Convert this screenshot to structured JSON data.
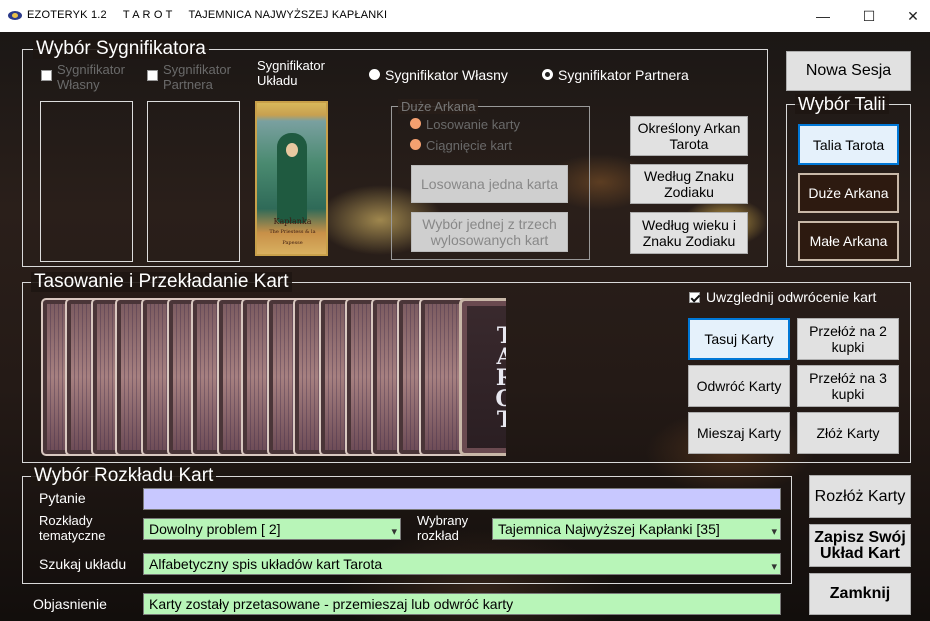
{
  "window": {
    "title": "EZOTERYK 1.2     T A R O T     TAJEMNICA NAJWYŻSZEJ KAPŁANKI",
    "min": "—",
    "max": "☐",
    "close": "✕"
  },
  "sygnifikator": {
    "legend": "Wybór Sygnifikatora",
    "own_label": "Sygnifikator Własny",
    "partner_label": "Sygnifikator Partnera",
    "layout_label": "Sygnifikator Układu",
    "radio_own": "Sygnifikator Własny",
    "radio_partner": "Sygnifikator Partnera",
    "card_caption": "Kapłanka",
    "card_caption_sub": "The Priestess & la Papesse"
  },
  "duze_arkana": {
    "legend": "Duże Arkana",
    "opt1": "Losowanie karty",
    "opt2": "Ciągnięcie kart",
    "btn1": "Losowana jedna karta",
    "btn2": "Wybór jednej z trzech wylosowanych kart"
  },
  "right_buttons": {
    "okreslony": "Określony Arkan Tarota",
    "znak": "Według Znaku Zodiaku",
    "wiek": "Według wieku i Znaku Zodiaku"
  },
  "nowa_sesja": "Nowa Sesja",
  "talia": {
    "legend": "Wybór Talii",
    "tarot": "Talia Tarota",
    "duze": "Duże Arkana",
    "male": "Małe Arkana"
  },
  "tasowanie": {
    "legend": "Tasowanie i Przekładanie Kart",
    "reverse_label": "Uwzglednij odwrócenie kart",
    "tasuj": "Tasuj Karty",
    "przeloz2": "Przełóż na 2 kupki",
    "odwroc": "Odwróć Karty",
    "przeloz3": "Przełóż na 3 kupki",
    "mieszaj": "Mieszaj Karty",
    "zloz": "Złóż Karty",
    "deck_text": "TAROT"
  },
  "rozklad": {
    "legend": "Wybór Rozkładu Kart",
    "pytanie_label": "Pytanie",
    "pytanie_value": "",
    "tematyczne_label": "Rozkłady tematyczne",
    "tematyczne_value": "Dowolny problem [ 2]",
    "wybrany_label": "Wybrany rozkład",
    "wybrany_value": "Tajemnica Najwyższej Kapłanki [35]",
    "szukaj_label": "Szukaj układu",
    "szukaj_value": "Alfabetyczny spis układów kart Tarota"
  },
  "objasnienie": {
    "label": "Objasnienie",
    "value": "Karty zostały przetasowane - przemieszaj lub odwróć karty"
  },
  "bottom_buttons": {
    "rozloz": "Rozłóż Karty",
    "zapisz": "Zapisz Swój Układ Kart",
    "zamknij": "Zamknij"
  },
  "colors": {
    "pytanie_bg": "#c8c8ff",
    "green_bg": "#b8f5b8",
    "accent": "#0078d7"
  }
}
